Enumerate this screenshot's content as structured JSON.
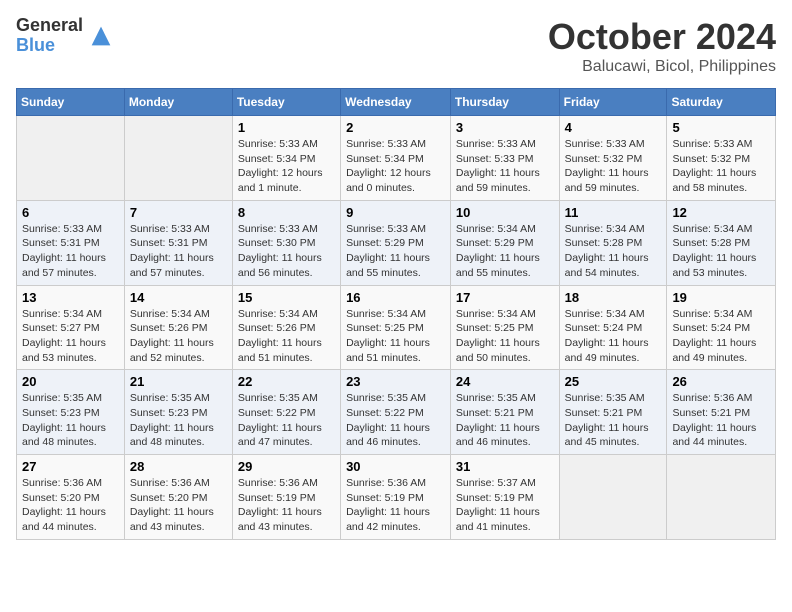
{
  "logo": {
    "general": "General",
    "blue": "Blue"
  },
  "header": {
    "title": "October 2024",
    "subtitle": "Balucawi, Bicol, Philippines"
  },
  "weekdays": [
    "Sunday",
    "Monday",
    "Tuesday",
    "Wednesday",
    "Thursday",
    "Friday",
    "Saturday"
  ],
  "weeks": [
    [
      {
        "day": "",
        "info": ""
      },
      {
        "day": "",
        "info": ""
      },
      {
        "day": "1",
        "info": "Sunrise: 5:33 AM\nSunset: 5:34 PM\nDaylight: 12 hours\nand 1 minute."
      },
      {
        "day": "2",
        "info": "Sunrise: 5:33 AM\nSunset: 5:34 PM\nDaylight: 12 hours\nand 0 minutes."
      },
      {
        "day": "3",
        "info": "Sunrise: 5:33 AM\nSunset: 5:33 PM\nDaylight: 11 hours\nand 59 minutes."
      },
      {
        "day": "4",
        "info": "Sunrise: 5:33 AM\nSunset: 5:32 PM\nDaylight: 11 hours\nand 59 minutes."
      },
      {
        "day": "5",
        "info": "Sunrise: 5:33 AM\nSunset: 5:32 PM\nDaylight: 11 hours\nand 58 minutes."
      }
    ],
    [
      {
        "day": "6",
        "info": "Sunrise: 5:33 AM\nSunset: 5:31 PM\nDaylight: 11 hours\nand 57 minutes."
      },
      {
        "day": "7",
        "info": "Sunrise: 5:33 AM\nSunset: 5:31 PM\nDaylight: 11 hours\nand 57 minutes."
      },
      {
        "day": "8",
        "info": "Sunrise: 5:33 AM\nSunset: 5:30 PM\nDaylight: 11 hours\nand 56 minutes."
      },
      {
        "day": "9",
        "info": "Sunrise: 5:33 AM\nSunset: 5:29 PM\nDaylight: 11 hours\nand 55 minutes."
      },
      {
        "day": "10",
        "info": "Sunrise: 5:34 AM\nSunset: 5:29 PM\nDaylight: 11 hours\nand 55 minutes."
      },
      {
        "day": "11",
        "info": "Sunrise: 5:34 AM\nSunset: 5:28 PM\nDaylight: 11 hours\nand 54 minutes."
      },
      {
        "day": "12",
        "info": "Sunrise: 5:34 AM\nSunset: 5:28 PM\nDaylight: 11 hours\nand 53 minutes."
      }
    ],
    [
      {
        "day": "13",
        "info": "Sunrise: 5:34 AM\nSunset: 5:27 PM\nDaylight: 11 hours\nand 53 minutes."
      },
      {
        "day": "14",
        "info": "Sunrise: 5:34 AM\nSunset: 5:26 PM\nDaylight: 11 hours\nand 52 minutes."
      },
      {
        "day": "15",
        "info": "Sunrise: 5:34 AM\nSunset: 5:26 PM\nDaylight: 11 hours\nand 51 minutes."
      },
      {
        "day": "16",
        "info": "Sunrise: 5:34 AM\nSunset: 5:25 PM\nDaylight: 11 hours\nand 51 minutes."
      },
      {
        "day": "17",
        "info": "Sunrise: 5:34 AM\nSunset: 5:25 PM\nDaylight: 11 hours\nand 50 minutes."
      },
      {
        "day": "18",
        "info": "Sunrise: 5:34 AM\nSunset: 5:24 PM\nDaylight: 11 hours\nand 49 minutes."
      },
      {
        "day": "19",
        "info": "Sunrise: 5:34 AM\nSunset: 5:24 PM\nDaylight: 11 hours\nand 49 minutes."
      }
    ],
    [
      {
        "day": "20",
        "info": "Sunrise: 5:35 AM\nSunset: 5:23 PM\nDaylight: 11 hours\nand 48 minutes."
      },
      {
        "day": "21",
        "info": "Sunrise: 5:35 AM\nSunset: 5:23 PM\nDaylight: 11 hours\nand 48 minutes."
      },
      {
        "day": "22",
        "info": "Sunrise: 5:35 AM\nSunset: 5:22 PM\nDaylight: 11 hours\nand 47 minutes."
      },
      {
        "day": "23",
        "info": "Sunrise: 5:35 AM\nSunset: 5:22 PM\nDaylight: 11 hours\nand 46 minutes."
      },
      {
        "day": "24",
        "info": "Sunrise: 5:35 AM\nSunset: 5:21 PM\nDaylight: 11 hours\nand 46 minutes."
      },
      {
        "day": "25",
        "info": "Sunrise: 5:35 AM\nSunset: 5:21 PM\nDaylight: 11 hours\nand 45 minutes."
      },
      {
        "day": "26",
        "info": "Sunrise: 5:36 AM\nSunset: 5:21 PM\nDaylight: 11 hours\nand 44 minutes."
      }
    ],
    [
      {
        "day": "27",
        "info": "Sunrise: 5:36 AM\nSunset: 5:20 PM\nDaylight: 11 hours\nand 44 minutes."
      },
      {
        "day": "28",
        "info": "Sunrise: 5:36 AM\nSunset: 5:20 PM\nDaylight: 11 hours\nand 43 minutes."
      },
      {
        "day": "29",
        "info": "Sunrise: 5:36 AM\nSunset: 5:19 PM\nDaylight: 11 hours\nand 43 minutes."
      },
      {
        "day": "30",
        "info": "Sunrise: 5:36 AM\nSunset: 5:19 PM\nDaylight: 11 hours\nand 42 minutes."
      },
      {
        "day": "31",
        "info": "Sunrise: 5:37 AM\nSunset: 5:19 PM\nDaylight: 11 hours\nand 41 minutes."
      },
      {
        "day": "",
        "info": ""
      },
      {
        "day": "",
        "info": ""
      }
    ]
  ]
}
